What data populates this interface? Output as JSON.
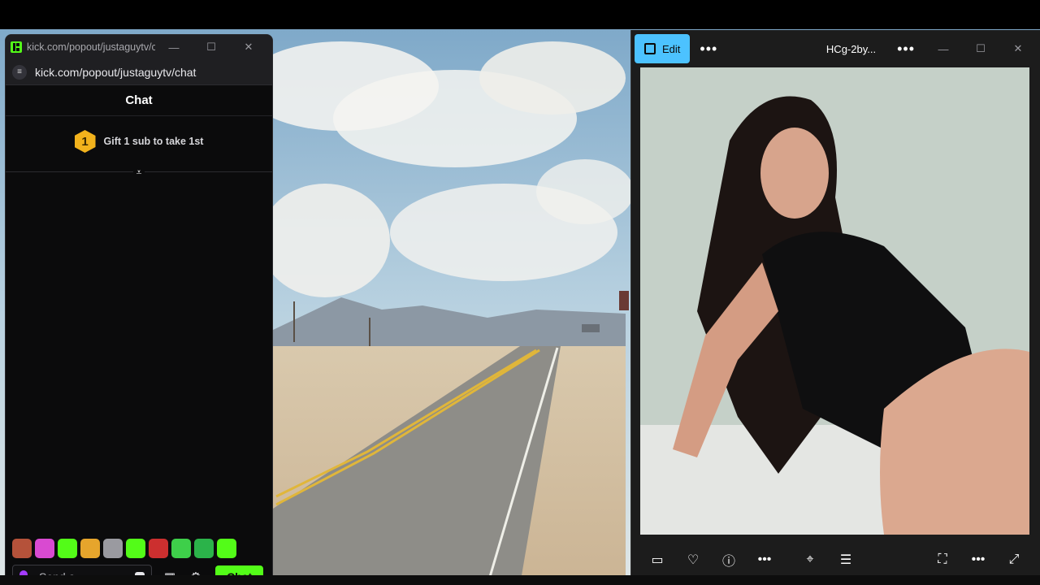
{
  "chat_window": {
    "tab_title": "kick.com/popout/justaguytv/c...",
    "url": "kick.com/popout/justaguytv/chat",
    "header": "Chat",
    "gift_badge_number": "1",
    "gift_text": "Gift 1 sub to take 1st",
    "input_placeholder": "Send a",
    "send_label": "Chat",
    "emotes": [
      "#b5523a",
      "#d94ad1",
      "#53fc18",
      "#e6a52c",
      "#9a9aa0",
      "#53fc18",
      "#cc2f2f",
      "#3ecf4a",
      "#2bb34a",
      "#53fc18"
    ],
    "accent": "#53fc18"
  },
  "photo_window": {
    "edit_label": "Edit",
    "file_name": "HCg-2by...",
    "accent": "#4cc2ff"
  },
  "icons": {
    "minimize": "—",
    "maximize": "☐",
    "close": "✕",
    "more": "•••",
    "heart": "♡",
    "info": "ⓘ",
    "settings": "⚙",
    "store": "▦",
    "scroll": "⩡"
  }
}
